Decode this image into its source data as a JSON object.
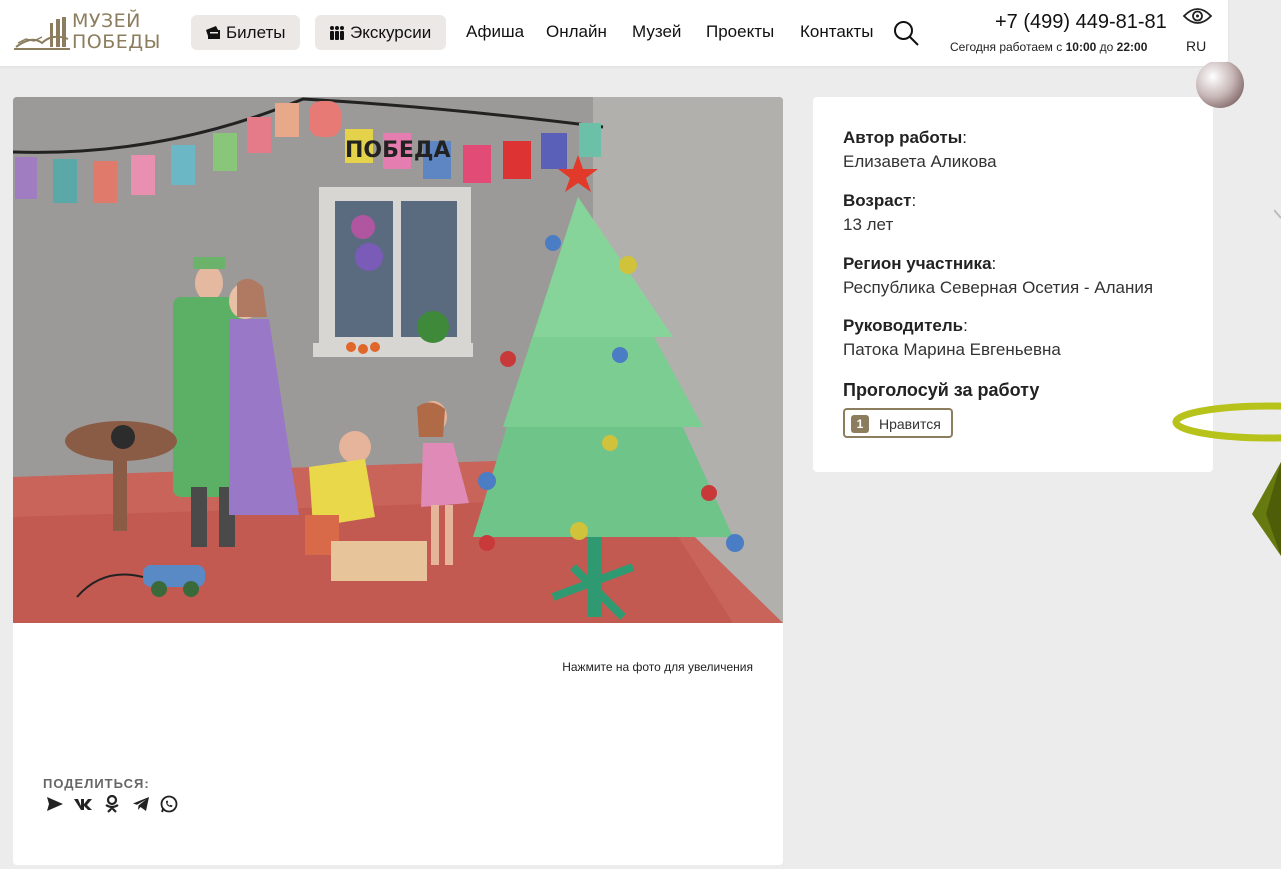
{
  "colors": {
    "accent": "#8b7d5e",
    "page_bg": "#ececec",
    "button_bg": "#ebe8e5"
  },
  "header": {
    "logo_line1": "Музей",
    "logo_line2": "Победы",
    "tickets_label": "Билеты",
    "tours_label": "Экскурсии",
    "nav": [
      "Афиша",
      "Онлайн",
      "Музей",
      "Проекты",
      "Контакты"
    ],
    "phone": "+7 (499) 449-81-81",
    "hours_prefix": "Сегодня работаем с",
    "hours_from": "10:00",
    "hours_mid": "до",
    "hours_to": "22:00",
    "language": "RU",
    "icons": {
      "tickets": "ticket-icon",
      "tours": "group-icon",
      "search": "search-icon",
      "accessibility": "eye-icon"
    }
  },
  "artwork": {
    "zoom_hint": "Нажмите на фото для увеличения",
    "banner_text": "ПОБЕДА",
    "share_label": "ПОДЕЛИТЬСЯ:",
    "share_icons": [
      "send-icon",
      "vk-icon",
      "odnoklassniki-icon",
      "telegram-icon",
      "whatsapp-icon"
    ]
  },
  "info": {
    "author_label": "Автор работы",
    "author_value": "Елизавета Аликова",
    "age_label": "Возраст",
    "age_value": "13 лет",
    "region_label": "Регион участника",
    "region_value": "Республика Северная Осетия - Алания",
    "supervisor_label": "Руководитель",
    "supervisor_value": "Патока Марина Евгеньевна",
    "vote_title": "Проголосуй за работу",
    "like_count": "1",
    "like_label": "Нравится"
  }
}
